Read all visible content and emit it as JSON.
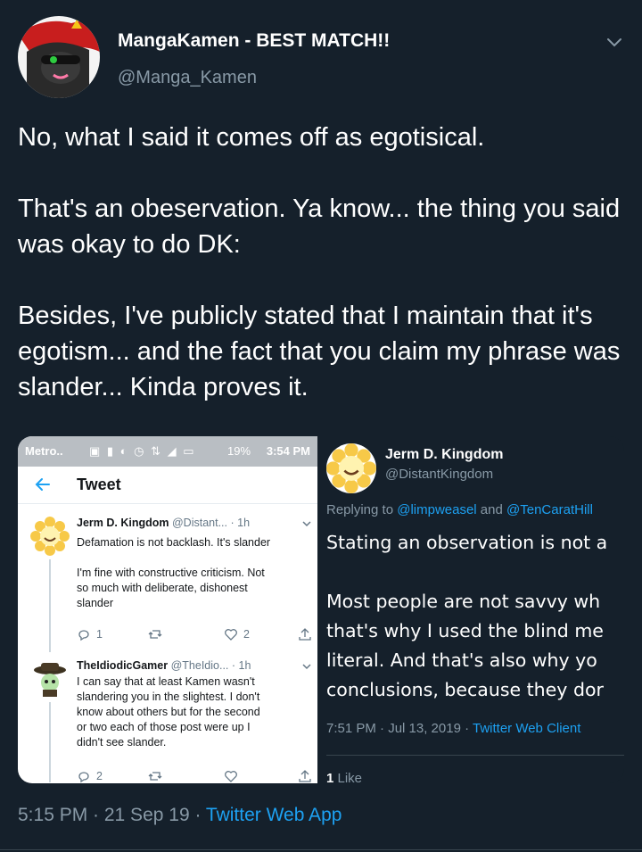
{
  "author": {
    "display_name": "MangaKamen - BEST MATCH!!",
    "handle": "@Manga_Kamen"
  },
  "tweet": {
    "paragraphs": [
      "No, what I said it comes off as egotisical.",
      "That's an obeservation. Ya know... the thing you said was okay to do DK:",
      "Besides, I've publicly stated that I maintain that it's egotism... and the fact that you claim my phrase was slander... Kinda proves it."
    ],
    "timestamp": "5:15 PM · 21 Sep 19 · ",
    "source": "Twitter Web App"
  },
  "screenshot": {
    "status_bar": {
      "carrier": "Metro..",
      "battery": "19%",
      "time": "3:54 PM"
    },
    "title": "Tweet",
    "tweets": [
      {
        "name": "Jerm D. Kingdom",
        "handle": "@Distant...",
        "time": "· 1h",
        "text": [
          "Defamation is not backlash. It's slander",
          "",
          "I'm fine with constructive criticism. Not",
          "so much with deliberate, dishonest",
          "slander"
        ],
        "replies": "1",
        "likes": "2"
      },
      {
        "name": "TheIdiodicGamer",
        "handle": "@TheIdio...",
        "time": "· 1h",
        "text": [
          "I can say that at least Kamen wasn't",
          "slandering you in the slightest. I don't",
          "know about others but for the second",
          "or two each of those post were up I",
          "didn't see slander."
        ],
        "replies": "2",
        "likes": ""
      }
    ]
  },
  "quoted": {
    "name": "Jerm D. Kingdom",
    "handle": "@DistantKingdom",
    "replying_prefix": "Replying to ",
    "replying_to_1": "@limpweasel",
    "replying_and": " and ",
    "replying_to_2": "@TenCaratHill",
    "lines": [
      "Stating an observation is not a",
      "",
      "Most people are not savvy wh",
      "that's why I used the blind me",
      "literal.  And that's also why yo",
      "conclusions, because they dor"
    ],
    "timestamp": "7:51 PM · Jul 13, 2019 · ",
    "source": "Twitter Web Client",
    "likes_count": "1",
    "likes_label": " Like"
  },
  "colors": {
    "background": "#15202b",
    "accent": "#1da1f2",
    "muted": "#8899a6"
  },
  "icons": {
    "caret": "chevron-down-icon",
    "back": "arrow-left-icon",
    "reply": "reply-icon",
    "retweet": "retweet-icon",
    "like": "heart-icon",
    "share": "share-icon"
  }
}
